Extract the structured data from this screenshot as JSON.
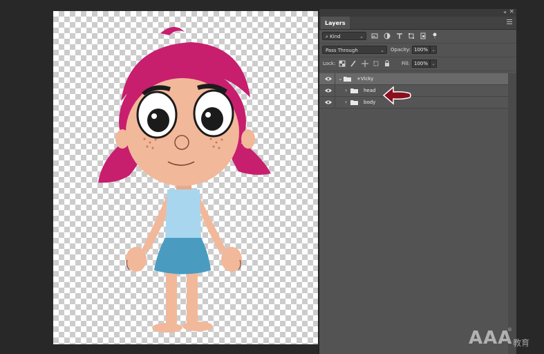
{
  "panel": {
    "tab_label": "Layers",
    "collapse_icon": "double-chevron-icon",
    "close_icon": "close-icon",
    "filter": {
      "kind_label": "Kind",
      "icons": [
        "image-filter-icon",
        "adjustment-filter-icon",
        "type-filter-icon",
        "shape-filter-icon",
        "smart-object-filter-icon",
        "toggle-dot-icon"
      ]
    },
    "blend_mode": "Pass Through",
    "opacity_label": "Opacity:",
    "opacity_value": "100%",
    "lock_label": "Lock:",
    "fill_label": "Fill:",
    "fill_value": "100%"
  },
  "layers": [
    {
      "name": "+Vicky",
      "type": "group",
      "expanded": true,
      "selected": true
    },
    {
      "name": "head",
      "type": "group",
      "expanded": false,
      "selected": false
    },
    {
      "name": "body",
      "type": "group",
      "expanded": false,
      "selected": false
    }
  ],
  "annotation": {
    "color": "#8a1020"
  },
  "watermark": {
    "text": "AAA",
    "mark": "®",
    "cn": "教育"
  },
  "colors": {
    "hair": "#c81e6e",
    "skin": "#f2b89a",
    "shirt": "#a8d6ee",
    "skirt": "#4a9bc0",
    "panel_bg": "#535353"
  }
}
